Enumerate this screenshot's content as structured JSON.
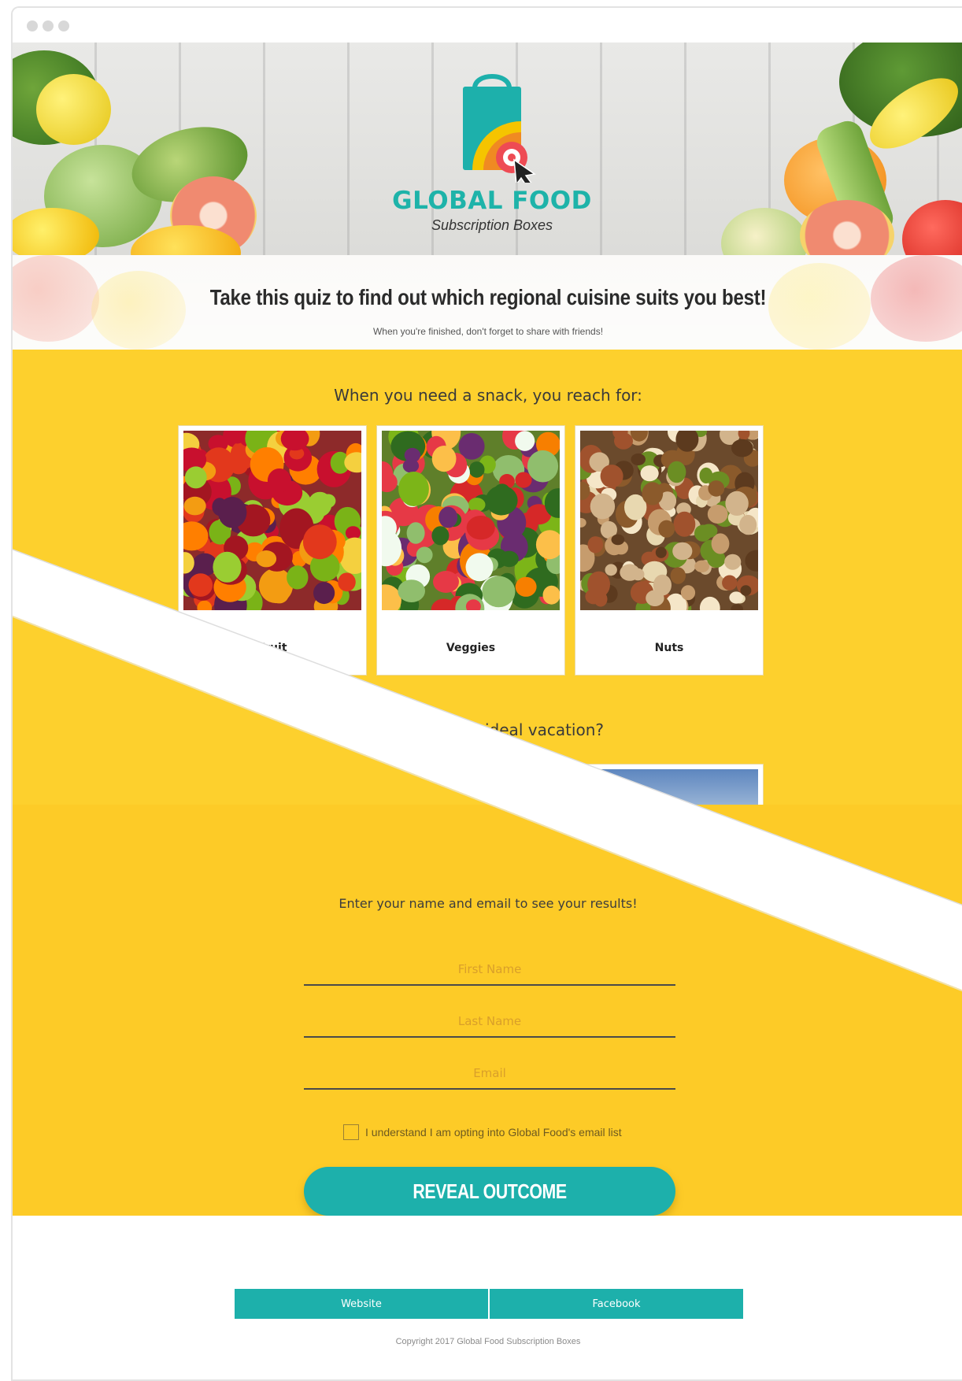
{
  "hero": {
    "brand_name": "GLOBAL FOOD",
    "brand_tagline": "Subscription Boxes",
    "logo_icon": "shopping-bag-target-cursor",
    "title": "Take this quiz to find out which regional cuisine suits you best!",
    "subtitle": "When you're finished, don't forget to share with friends!"
  },
  "quiz": {
    "question_1": {
      "text": "When you need a snack, you reach for:",
      "options": [
        {
          "label": "Fruit",
          "image": "fruit-photo"
        },
        {
          "label": "Veggies",
          "image": "veggies-photo"
        },
        {
          "label": "Nuts",
          "image": "nuts-photo"
        }
      ]
    },
    "question_2": {
      "text_visible": "ideal vacation?",
      "image": "beach-sky-photo"
    }
  },
  "form": {
    "title": "Enter your name and email to see your results!",
    "first_name_placeholder": "First Name",
    "last_name_placeholder": "Last Name",
    "email_placeholder": "Email",
    "optin_label": "I understand I am opting into Global Food's email list",
    "submit_label": "REVEAL OUTCOME"
  },
  "footer": {
    "links": [
      "Website",
      "Facebook"
    ],
    "copyright": "Copyright 2017 Global Food Subscription Boxes"
  },
  "colors": {
    "teal": "#1db0ab",
    "yellow": "#fdd02d",
    "text_dark": "#2b2b2b"
  }
}
